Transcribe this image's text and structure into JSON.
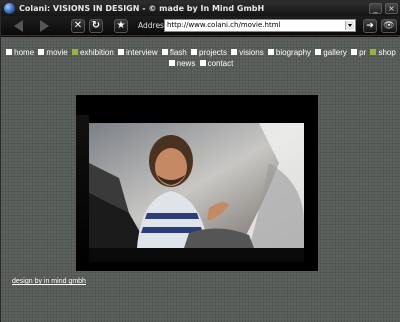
{
  "window": {
    "title": "Colani: VISIONS IN DESIGN - © made by In Mind GmbH"
  },
  "toolbar": {
    "address_label": "Address",
    "address_value": "http://www.colani.ch/movie.html"
  },
  "nav": {
    "items": [
      {
        "label": "home",
        "active": false
      },
      {
        "label": "movie",
        "active": false
      },
      {
        "label": "exhibition",
        "active": true
      },
      {
        "label": "interview",
        "active": false
      },
      {
        "label": "flash",
        "active": false
      },
      {
        "label": "projects",
        "active": false
      },
      {
        "label": "visions",
        "active": false
      },
      {
        "label": "biography",
        "active": false
      },
      {
        "label": "gallery",
        "active": false
      },
      {
        "label": "pr",
        "active": false
      },
      {
        "label": "shop",
        "active": true
      },
      {
        "label": "news",
        "active": false
      },
      {
        "label": "contact",
        "active": false
      }
    ]
  },
  "footer": {
    "credit": "design by in mind gmbh"
  },
  "colors": {
    "background": "#5d615d",
    "active_bullet": "#98b23a"
  }
}
